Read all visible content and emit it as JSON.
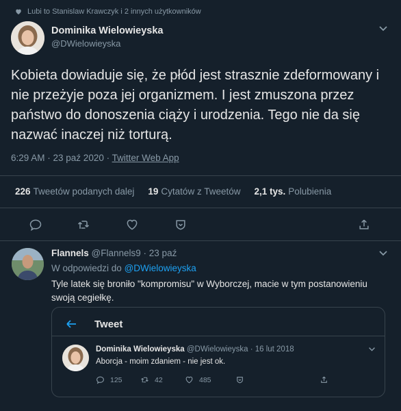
{
  "context": {
    "liked_text": "Lubi to Stanislaw Krawczyk i 2 innych użytkowników",
    "icon": "heart-icon"
  },
  "main_tweet": {
    "author_name": "Dominika Wielowieyska",
    "author_handle": "@DWielowieyska",
    "text": "Kobieta dowiaduje się, że płód jest strasznie zdeformowany i nie przeżyje poza jej organizmem. I jest zmuszona przez państwo do donoszenia ciąży i urodzenia. Tego nie da się nazwać inaczej niż torturą.",
    "time": "6:29 AM · 23 paź 2020 · ",
    "source": "Twitter Web App",
    "stats": {
      "retweets_count": "226",
      "retweets_label": "Tweetów podanych dalej",
      "quotes_count": "19",
      "quotes_label": "Cytatów z Tweetów",
      "likes_count": "2,1 tys.",
      "likes_label": "Polubienia"
    }
  },
  "reply": {
    "author_name": "Flannels",
    "author_handle": "@Flannels9",
    "date": "· 23 paź",
    "reply_prefix": "W odpowiedzi do ",
    "reply_to": "@DWielowieyska",
    "text": "Tyle latek się broniło \"kompromisu\"  w Wyborczej, macie w tym postanowieniu swoją cegiełkę."
  },
  "quoted": {
    "header_title": "Tweet",
    "author_name": "Dominika Wielowieyska",
    "author_handle": "@DWielowieyska",
    "date": "· 16 lut 2018",
    "text": "Aborcja - moim zdaniem - nie jest ok.",
    "actions": {
      "replies": "125",
      "retweets": "42",
      "likes": "485"
    }
  },
  "colors": {
    "background": "#15202b",
    "accent": "#1da1f2",
    "muted": "#8899a6",
    "separator": "#38444d"
  }
}
